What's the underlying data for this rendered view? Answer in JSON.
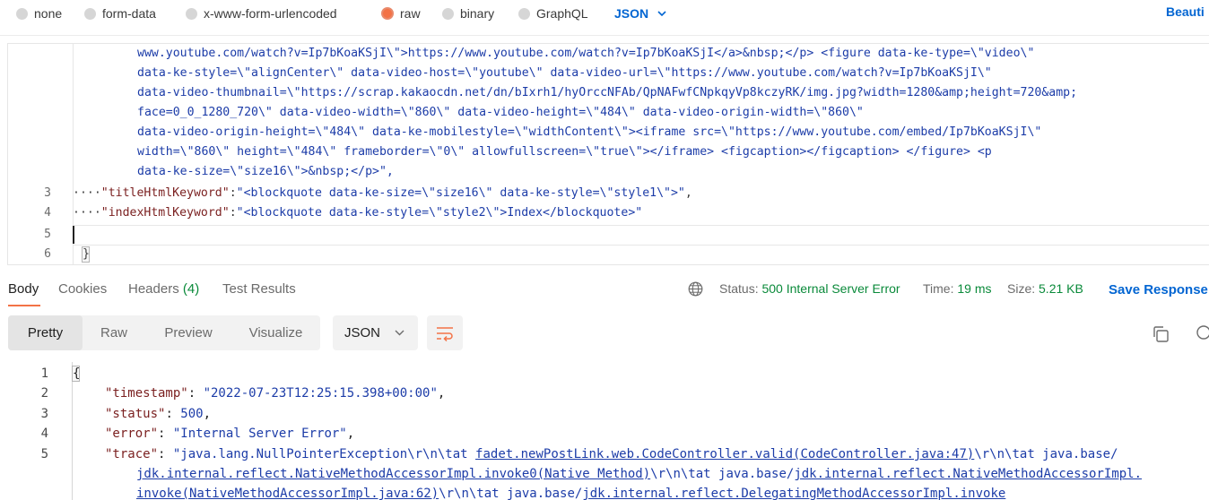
{
  "body_types": {
    "options": [
      "none",
      "form-data",
      "x-www-form-urlencoded",
      "raw",
      "binary",
      "GraphQL"
    ],
    "selected": "raw",
    "language": "JSON",
    "beautify_label": "Beauti"
  },
  "request_editor": {
    "wrapped_lines": [
      "www.youtube.com/watch?v=Ip7bKoaKSjI\\\">https://www.youtube.com/watch?v=Ip7bKoaKSjI</a>&nbsp;</p> <figure data-ke-type=\\\"video\\\"",
      "data-ke-style=\\\"alignCenter\\\" data-video-host=\\\"youtube\\\" data-video-url=\\\"https://www.youtube.com/watch?v=Ip7bKoaKSjI\\\"",
      "data-video-thumbnail=\\\"https://scrap.kakaocdn.net/dn/bIxrh1/hyOrccNFAb/QpNAFwfCNpkqyVp8kczyRK/img.jpg?width=1280&amp;height=720&amp;",
      "face=0_0_1280_720\\\" data-video-width=\\\"860\\\" data-video-height=\\\"484\\\" data-video-origin-width=\\\"860\\\"",
      "data-video-origin-height=\\\"484\\\" data-ke-mobilestyle=\\\"widthContent\\\"><iframe src=\\\"https://www.youtube.com/embed/Ip7bKoaKSjI\\\"",
      "width=\\\"860\\\" height=\\\"484\\\" frameborder=\\\"0\\\" allowfullscreen=\\\"true\\\"></iframe> <figcaption></figcaption> </figure> <p",
      "data-ke-size=\\\"size16\\\">&nbsp;</p>\","
    ],
    "line3": {
      "number": "3",
      "key": "\"titleHtmlKeyword\"",
      "value": "\"<blockquote data-ke-size=\\\"size16\\\" data-ke-style=\\\"style1\\\">\"",
      "trail": ","
    },
    "line4": {
      "number": "4",
      "key": "\"indexHtmlKeyword\"",
      "value": "\"<blockquote data-ke-style=\\\"style2\\\">Index</blockquote>\""
    },
    "line5": {
      "number": "5"
    },
    "line6": {
      "number": "6",
      "text": "}"
    }
  },
  "response": {
    "tabs": {
      "body": "Body",
      "cookies": "Cookies",
      "headers": "Headers",
      "headers_count": "(4)",
      "tests": "Test Results"
    },
    "status_label": "Status:",
    "status_value": "500 Internal Server Error",
    "time_label": "Time:",
    "time_value": "19 ms",
    "size_label": "Size:",
    "size_value": "5.21 KB",
    "save_label": "Save Response",
    "views": [
      "Pretty",
      "Raw",
      "Preview",
      "Visualize"
    ],
    "active_view": "Pretty",
    "format": "JSON",
    "lines": {
      "l1": "{",
      "l2_key": "\"timestamp\"",
      "l2_val": "\"2022-07-23T12:25:15.398+00:00\"",
      "l3_key": "\"status\"",
      "l3_val": "500",
      "l4_key": "\"error\"",
      "l4_val": "\"Internal Server Error\"",
      "l5_key": "\"trace\"",
      "l5_a": "\"java.lang.NullPointerException\\r\\n\\tat ",
      "l5_b": "fadet.newPostLink.web.CodeController.valid(CodeController.java:47)",
      "l5_c": "\\r\\n\\tat java.base/",
      "l5_d": "jdk.internal.reflect.NativeMethodAccessorImpl.invoke0(Native Method)",
      "l5_e": "\\r\\n\\tat java.base/",
      "l5_f": "jdk.internal.reflect.NativeMethodAccessorImpl.",
      "l5_g": "invoke(NativeMethodAccessorImpl.java:62)",
      "l5_h": "\\r\\n\\tat java.base/",
      "l5_i": "jdk.internal.reflect.DelegatingMethodAccessorImpl.invoke"
    }
  },
  "colors": {
    "accent": "#f37246",
    "link": "#0265d2",
    "success": "#0a8a3a"
  }
}
